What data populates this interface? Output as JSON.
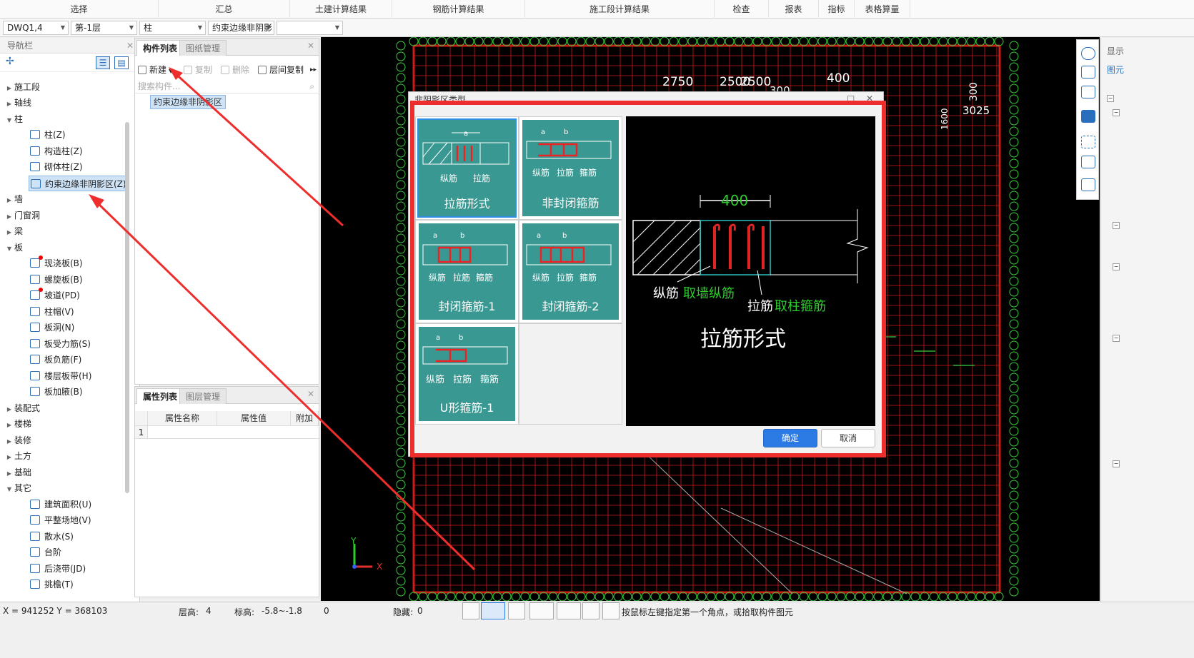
{
  "ribbon": {
    "tabs": [
      "选择",
      "汇总",
      "土建计算结果",
      "钢筋计算结果",
      "施工段计算结果",
      "检查",
      "报表",
      "指标",
      "表格算量"
    ]
  },
  "selectors": {
    "drawing": "DWQ1,4",
    "floor": "第-1层",
    "category": "柱",
    "component_type": "约束边缘非阴影",
    "component_name": ""
  },
  "nav": {
    "title": "导航栏",
    "groups": {
      "construction_segment": "施工段",
      "axis": "轴线",
      "column": "柱",
      "wall": "墙",
      "door_window": "门窗洞",
      "beam": "梁",
      "slab": "板",
      "prefab": "装配式",
      "stairs": "楼梯",
      "decoration": "装修",
      "earthwork": "土方",
      "foundation": "基础",
      "other": "其它"
    },
    "column_items": [
      "柱(Z)",
      "构造柱(Z)",
      "砌体柱(Z)",
      "约束边缘非阴影区(Z)"
    ],
    "slab_items": [
      "现浇板(B)",
      "螺旋板(B)",
      "坡道(PD)",
      "柱帽(V)",
      "板洞(N)",
      "板受力筋(S)",
      "板负筋(F)",
      "楼层板带(H)",
      "板加腋(B)"
    ],
    "other_items": [
      "建筑面积(U)",
      "平整场地(V)",
      "散水(S)",
      "台阶",
      "后浇带(JD)",
      "挑檐(T)"
    ]
  },
  "component_panel": {
    "tabs": [
      "构件列表",
      "图纸管理"
    ],
    "toolbar": {
      "new": "新建",
      "copy": "复制",
      "delete": "删除",
      "floor_copy": "层间复制"
    },
    "search_placeholder": "搜索构件...",
    "items": [
      "约束边缘非阴影区"
    ]
  },
  "property_panel": {
    "tabs": [
      "属性列表",
      "图层管理"
    ],
    "headers": [
      "属性名称",
      "属性值",
      "附加"
    ],
    "row_index": "1"
  },
  "cad": {
    "dims": {
      "d1": "2750",
      "d2": "2500",
      "d3": "2500",
      "d4": "400",
      "d5": "300",
      "d6": "300",
      "d7": "3025",
      "d8": "1600"
    },
    "axis_x": "X",
    "axis_y": "Y"
  },
  "dialog": {
    "title": "非阴影区类型",
    "options": [
      "拉筋形式",
      "非封闭箍筋",
      "封闭箍筋-1",
      "封闭箍筋-2",
      "U形箍筋-1"
    ],
    "option_sublabels": {
      "a": "a",
      "b": "b",
      "long_bar": "纵筋",
      "tie": "拉筋",
      "stirrup": "箍筋"
    },
    "preview": {
      "dim": "400",
      "long_bar": "纵筋",
      "long_bar_note": "取墙纵筋",
      "tie": "拉筋",
      "tie_note": "取柱箍筋",
      "caption": "拉筋形式"
    },
    "ok": "确定",
    "cancel": "取消"
  },
  "right_panel": {
    "title": "显示",
    "tab": "图元"
  },
  "status": {
    "coords": "X = 941252 Y = 368103",
    "floor_height_label": "层高:",
    "floor_height": "4",
    "elevation_label": "标高:",
    "elevation": "-5.8~-1.8",
    "zero": "0",
    "hidden_label": "隐藏:",
    "hidden": "0",
    "hint": "按鼠标左键指定第一个角点，或拾取构件图元"
  },
  "colors": {
    "accent": "#2c7be5",
    "annotation_red": "#ee2d2d",
    "option_teal": "#3a9892",
    "grid_red": "#d11b1b",
    "cad_green": "#3dcf3d"
  }
}
